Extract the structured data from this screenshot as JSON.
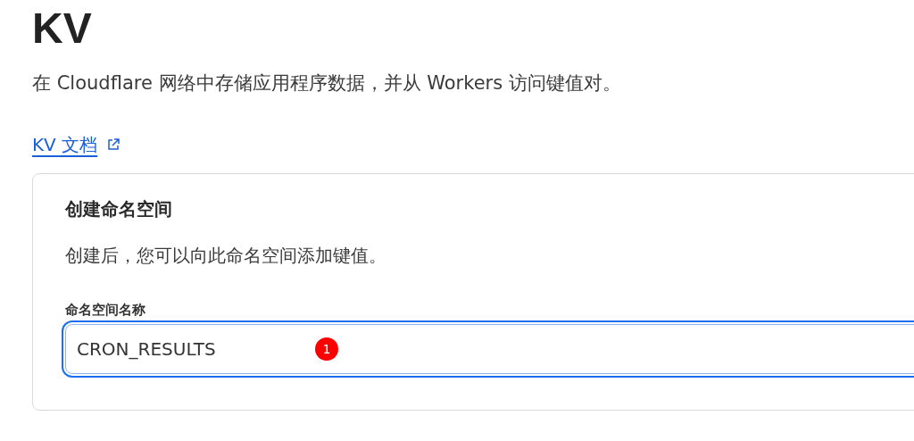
{
  "page": {
    "title": "KV",
    "description": "在 Cloudflare 网络中存储应用程序数据，并从 Workers 访问键值对。",
    "docs_link": "KV 文档"
  },
  "card": {
    "title": "创建命名空间",
    "description": "创建后，您可以向此命名空间添加键值。",
    "field": {
      "label": "命名空间名称",
      "value": "CRON_RESULTS",
      "focused": true
    },
    "marker": "1"
  }
}
